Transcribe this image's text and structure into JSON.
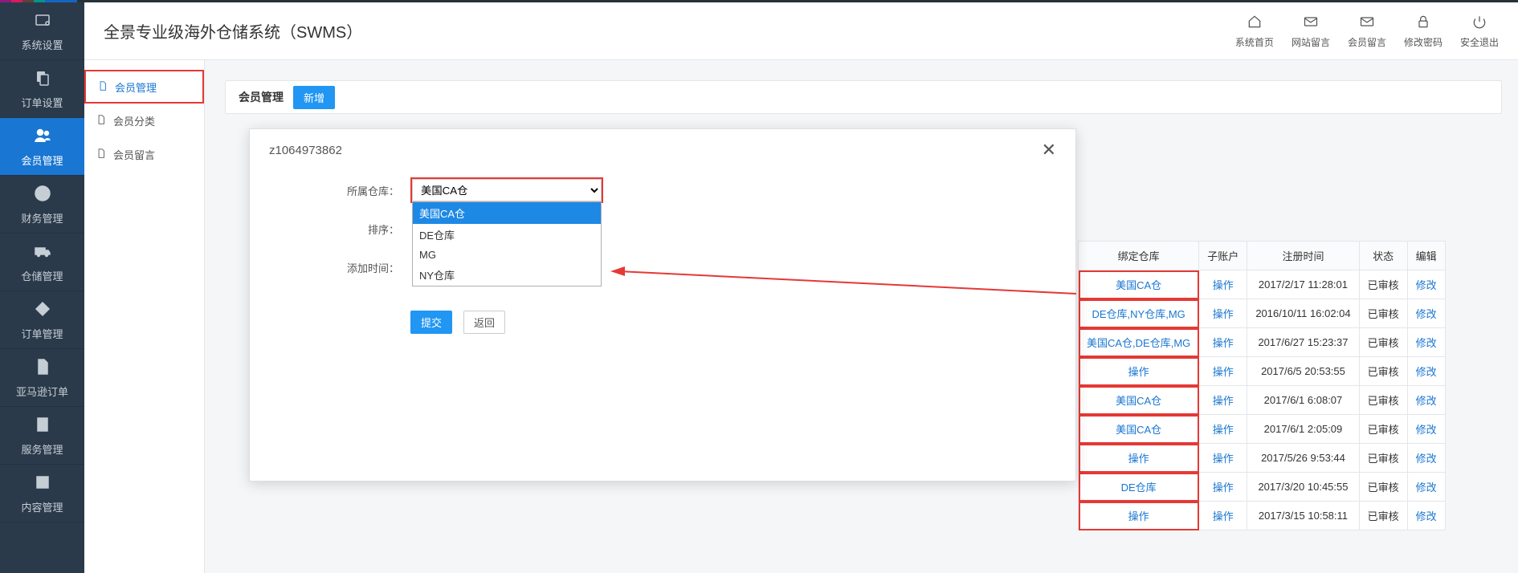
{
  "colors": {
    "stripe": [
      "#8d1b83",
      "#d81b60",
      "#5e4037",
      "#009688",
      "#1565c0",
      "#263238"
    ]
  },
  "appTitle": "全景专业级海外仓储系统（SWMS）",
  "topActions": [
    {
      "label": "系统首页",
      "icon": "home"
    },
    {
      "label": "网站留言",
      "icon": "mail"
    },
    {
      "label": "会员留言",
      "icon": "mail"
    },
    {
      "label": "修改密码",
      "icon": "lock"
    },
    {
      "label": "安全退出",
      "icon": "power"
    }
  ],
  "sidebarMain": [
    {
      "label": "系统设置",
      "icon": "gear"
    },
    {
      "label": "订单设置",
      "icon": "copy"
    },
    {
      "label": "会员管理",
      "icon": "users",
      "active": true
    },
    {
      "label": "财务管理",
      "icon": "yen"
    },
    {
      "label": "仓储管理",
      "icon": "truck"
    },
    {
      "label": "订单管理",
      "icon": "tag"
    },
    {
      "label": "亚马逊订单",
      "icon": "doc"
    },
    {
      "label": "服务管理",
      "icon": "page"
    },
    {
      "label": "内容管理",
      "icon": "word"
    }
  ],
  "sidebarSub": [
    {
      "label": "会员管理",
      "active": true
    },
    {
      "label": "会员分类"
    },
    {
      "label": "会员留言"
    }
  ],
  "crumb": {
    "title": "会员管理",
    "addBtn": "新增"
  },
  "modal": {
    "title": "z1064973862",
    "labels": {
      "warehouse": "所属仓库：",
      "sort": "排序：",
      "addedAt": "添加时间："
    },
    "selected": "美国CA仓",
    "options": [
      "美国CA仓",
      "DE仓库",
      "MG",
      "NY仓库"
    ],
    "btns": {
      "submit": "提交",
      "back": "返回"
    }
  },
  "tableHead": [
    "绑定仓库",
    "子账户",
    "注册时间",
    "状态",
    "编辑"
  ],
  "tableRows": [
    {
      "wh": "美国CA仓",
      "sub": "操作",
      "time": "2017/2/17 11:28:01",
      "st": "已审核",
      "ed": "修改"
    },
    {
      "wh": "DE仓库,NY仓库,MG",
      "sub": "操作",
      "time": "2016/10/11 16:02:04",
      "st": "已审核",
      "ed": "修改"
    },
    {
      "wh": "美国CA仓,DE仓库,MG",
      "sub": "操作",
      "time": "2017/6/27 15:23:37",
      "st": "已审核",
      "ed": "修改"
    },
    {
      "wh": "操作",
      "sub": "操作",
      "time": "2017/6/5 20:53:55",
      "st": "已审核",
      "ed": "修改"
    },
    {
      "wh": "美国CA仓",
      "sub": "操作",
      "time": "2017/6/1 6:08:07",
      "st": "已审核",
      "ed": "修改"
    },
    {
      "wh": "美国CA仓",
      "sub": "操作",
      "time": "2017/6/1 2:05:09",
      "st": "已审核",
      "ed": "修改"
    },
    {
      "wh": "操作",
      "sub": "操作",
      "time": "2017/5/26 9:53:44",
      "st": "已审核",
      "ed": "修改"
    },
    {
      "wh": "DE仓库",
      "sub": "操作",
      "time": "2017/3/20 10:45:55",
      "st": "已审核",
      "ed": "修改"
    },
    {
      "wh": "操作",
      "sub": "操作",
      "time": "2017/3/15 10:58:11",
      "st": "已审核",
      "ed": "修改"
    }
  ]
}
